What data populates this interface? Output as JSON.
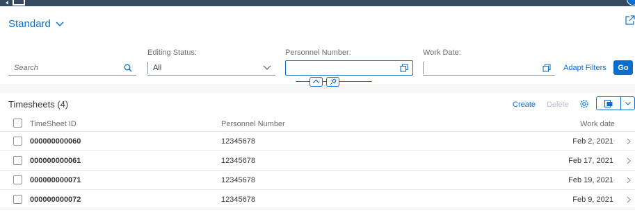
{
  "variant": {
    "label": "Standard"
  },
  "filters": {
    "search_placeholder": "Search",
    "editing_status_label": "Editing Status:",
    "editing_status_value": "All",
    "personnel_label": "Personnel Number:",
    "personnel_value": "",
    "work_date_label": "Work Date:",
    "work_date_value": "",
    "adapt_label": "Adapt Filters",
    "go_label": "Go"
  },
  "table": {
    "title": "Timesheets (4)",
    "create_label": "Create",
    "delete_label": "Delete",
    "columns": [
      "TimeSheet ID",
      "Personnel Number",
      "Work date"
    ],
    "rows": [
      {
        "id": "000000000060",
        "personnel": "12345678",
        "date": "Feb 2, 2021"
      },
      {
        "id": "000000000061",
        "personnel": "12345678",
        "date": "Feb 17, 2021"
      },
      {
        "id": "000000000071",
        "personnel": "12345678",
        "date": "Feb 19, 2021"
      },
      {
        "id": "000000000072",
        "personnel": "12345678",
        "date": "Feb 9, 2021"
      }
    ]
  },
  "colors": {
    "brand": "#0a6ed1",
    "shell": "#354a5f",
    "disabled": "#b6c0cb"
  },
  "icons": {
    "variant": "chevron-down-icon",
    "share": "share-icon",
    "search": "search-icon",
    "select": "chevron-down-icon",
    "value_help": "value-help-icon",
    "collapse": "chevron-up-icon",
    "pin": "pin-icon",
    "settings": "gear-icon",
    "export": "export-icon",
    "row_nav": "chevron-right-icon"
  }
}
